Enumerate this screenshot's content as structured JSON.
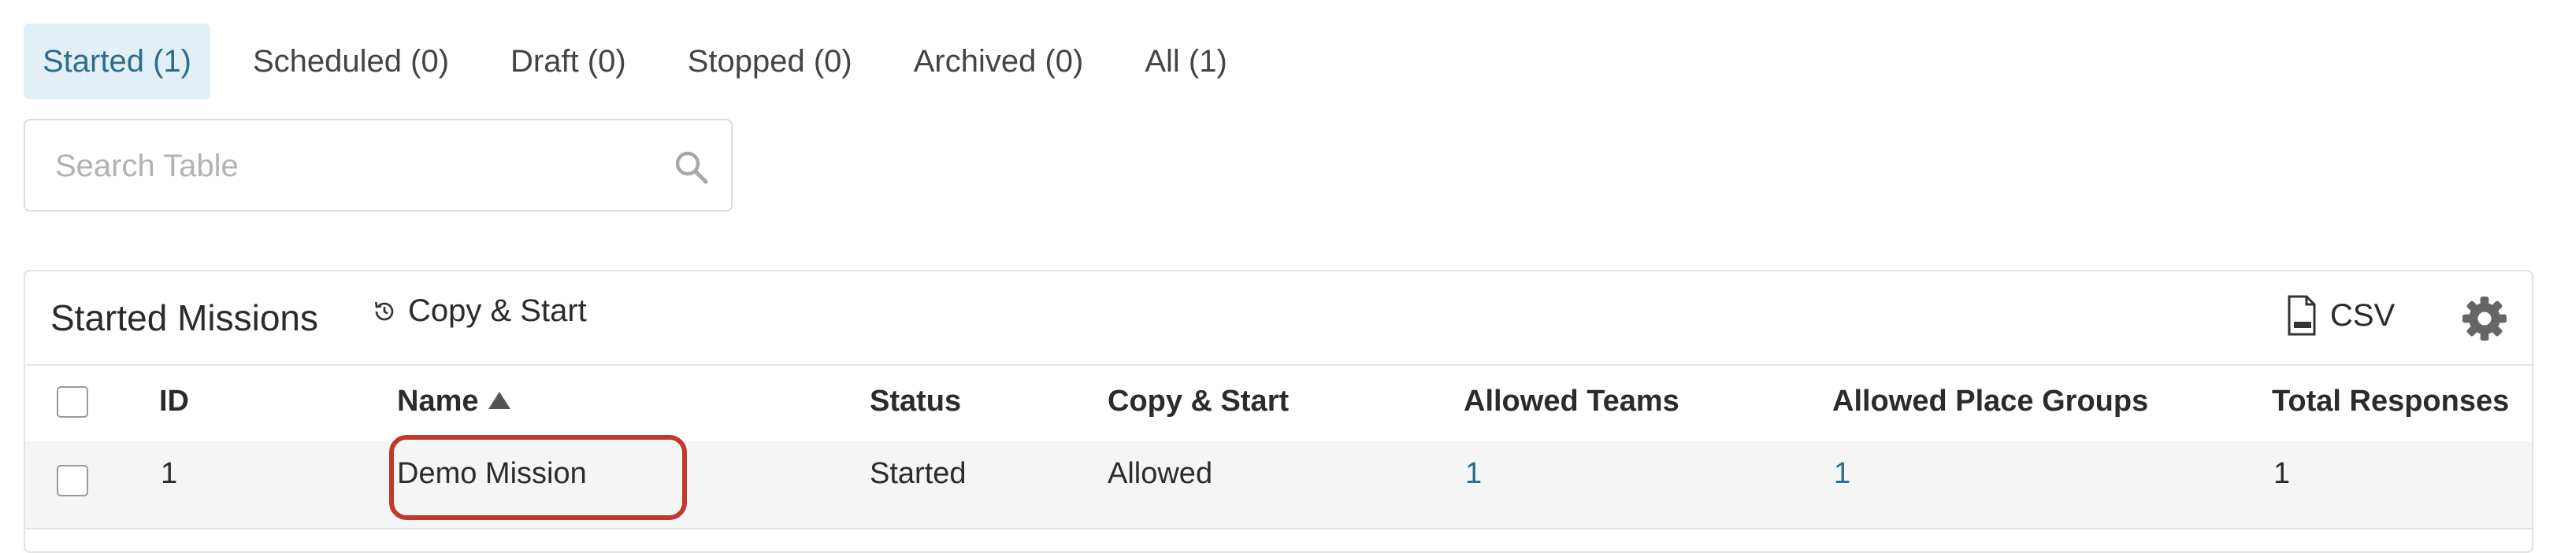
{
  "tabs": [
    {
      "label": "Started (1)",
      "active": true
    },
    {
      "label": "Scheduled (0)",
      "active": false
    },
    {
      "label": "Draft (0)",
      "active": false
    },
    {
      "label": "Stopped (0)",
      "active": false
    },
    {
      "label": "Archived (0)",
      "active": false
    },
    {
      "label": "All (1)",
      "active": false
    }
  ],
  "search": {
    "placeholder": "Search Table",
    "value": "",
    "icon": "search-icon"
  },
  "panel": {
    "title": "Started Missions",
    "copy_start_label": "Copy & Start",
    "copy_start_icon": "history-icon",
    "csv_label": "CSV",
    "csv_icon": "csv-file-icon",
    "settings_icon": "gear-icon"
  },
  "table": {
    "columns": [
      "ID",
      "Name",
      "Status",
      "Copy & Start",
      "Allowed Teams",
      "Allowed Place Groups",
      "Total Responses"
    ],
    "sort": {
      "column": "Name",
      "direction": "ascending"
    },
    "rows": [
      {
        "id": "1",
        "name": "Demo Mission",
        "status": "Started",
        "copy_start": "Allowed",
        "allowed_teams": "1",
        "allowed_place_groups": "1",
        "total_responses": "1"
      }
    ]
  },
  "colors": {
    "accent": "#2b6d8e",
    "active_tab_bg": "#e2eff7",
    "highlight": "#c0392b"
  }
}
